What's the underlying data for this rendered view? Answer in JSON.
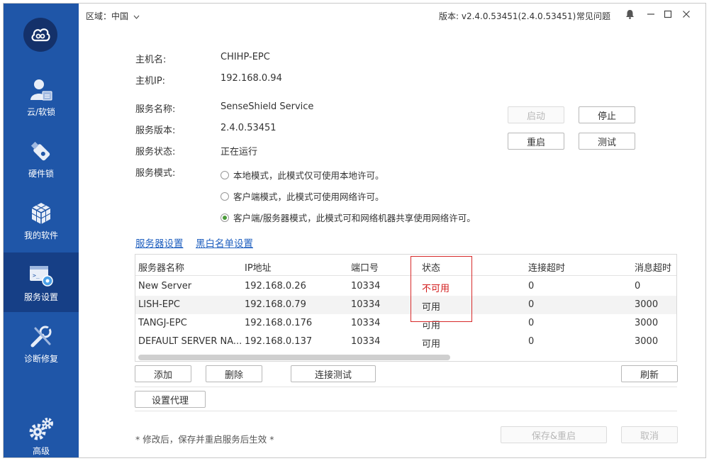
{
  "sidebar": {
    "items": [
      {
        "label": "云/软锁",
        "icon": "user-lock-icon"
      },
      {
        "label": "硬件锁",
        "icon": "usb-key-icon"
      },
      {
        "label": "我的软件",
        "icon": "cubes-icon"
      },
      {
        "label": "服务设置",
        "icon": "service-settings-icon",
        "active": true
      },
      {
        "label": "诊断修复",
        "icon": "repair-tools-icon"
      },
      {
        "label": "高级",
        "icon": "gears-icon"
      }
    ]
  },
  "titlebar": {
    "region_label": "区域：",
    "region_value": "中国",
    "version": "版本: v2.4.0.53451(2.4.0.53451)",
    "faq": "常见问题"
  },
  "host": {
    "name_label": "主机名:",
    "name_value": "CHIHP-EPC",
    "ip_label": "主机IP:",
    "ip_value": "192.168.0.94"
  },
  "service": {
    "name_label": "服务名称:",
    "name_value": "SenseShield Service",
    "version_label": "服务版本:",
    "version_value": "2.4.0.53451",
    "status_label": "服务状态:",
    "status_value": "正在运行",
    "mode_label": "服务模式:",
    "modes": [
      {
        "label": "本地模式，此模式仅可使用本地许可。",
        "selected": false
      },
      {
        "label": "客户端模式，此模式可使用网络许可。",
        "selected": false
      },
      {
        "label": "客户端/服务器模式，此模式可和网络机器共享使用网络许可。",
        "selected": true
      }
    ],
    "buttons": {
      "start": "启动",
      "stop": "停止",
      "restart": "重启",
      "test": "测试"
    }
  },
  "tabs": {
    "server_settings": "服务器设置",
    "blacklist": "黑白名单设置"
  },
  "table": {
    "headers": [
      "服务器名称",
      "IP地址",
      "端口号",
      "状态",
      "连接超时",
      "消息超时"
    ],
    "rows": [
      {
        "name": "New Server",
        "ip": "192.168.0.26",
        "port": "10334",
        "status": "不可用",
        "conn_timeout": "0",
        "msg_timeout": "0"
      },
      {
        "name": "LISH-EPC",
        "ip": "192.168.0.79",
        "port": "10334",
        "status": "可用",
        "conn_timeout": "0",
        "msg_timeout": "3000"
      },
      {
        "name": "TANGJ-EPC",
        "ip": "192.168.0.176",
        "port": "10334",
        "status": "可用",
        "conn_timeout": "0",
        "msg_timeout": "3000"
      },
      {
        "name": "DEFAULT SERVER NA...",
        "ip": "192.168.0.137",
        "port": "10334",
        "status": "可用",
        "conn_timeout": "0",
        "msg_timeout": "3000"
      }
    ]
  },
  "table_buttons": {
    "add": "添加",
    "delete": "删除",
    "connect_test": "连接测试",
    "refresh": "刷新",
    "proxy": "设置代理"
  },
  "footer": {
    "note": "* 修改后，保存并重启服务后生效 *",
    "save_restart": "保存&重启",
    "cancel": "取消"
  },
  "colors": {
    "sidebar": "#1f56a8",
    "sidebar_active": "#163f86",
    "link": "#1f5fbf",
    "unavailable": "#d21a1a",
    "highlight_box": "#d72a2a"
  }
}
